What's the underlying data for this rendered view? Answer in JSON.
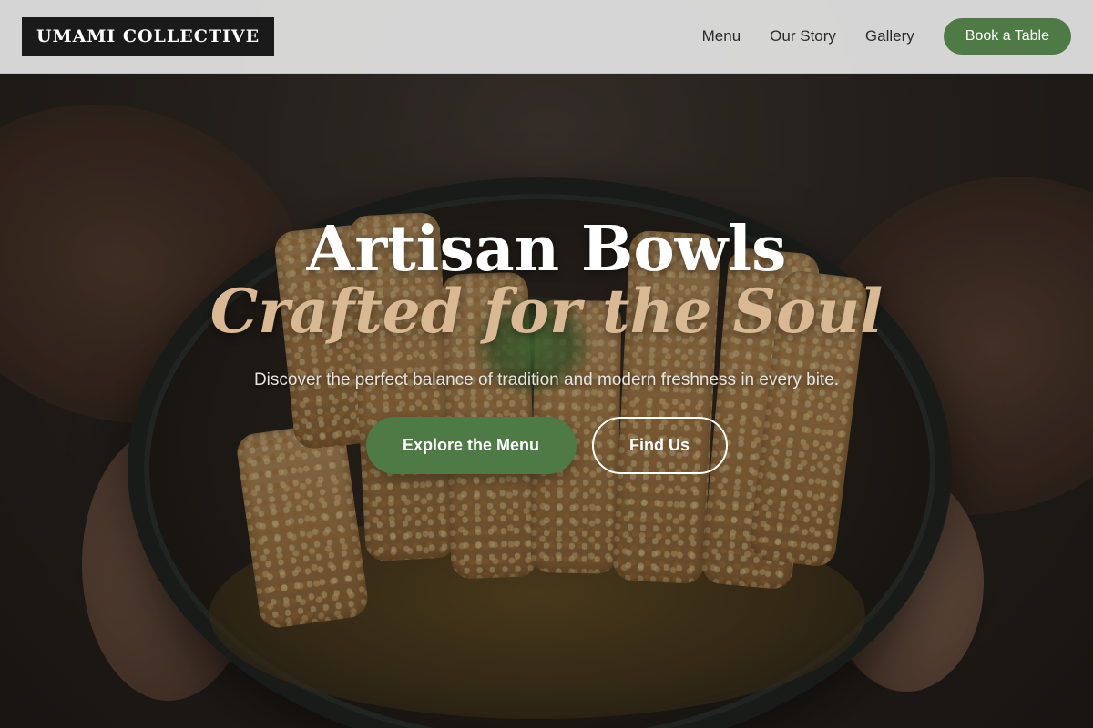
{
  "brand": {
    "name": "UMAMI COLLECTIVE"
  },
  "nav": {
    "links": [
      "Menu",
      "Our Story",
      "Gallery"
    ],
    "cta_label": "Book a Table"
  },
  "hero": {
    "headline_line1": "Artisan Bowls",
    "headline_line2": "Crafted for the Soul",
    "subtitle": "Discover the perfect balance of tradition and modern freshness in every bite.",
    "primary_button": "Explore the Menu",
    "secondary_button": "Find Us"
  },
  "colors": {
    "accent_green": "#4e7a45",
    "headline_tan": "#d9b994",
    "nav_background": "#e1e1e1",
    "logo_background": "#1a1a1a"
  }
}
